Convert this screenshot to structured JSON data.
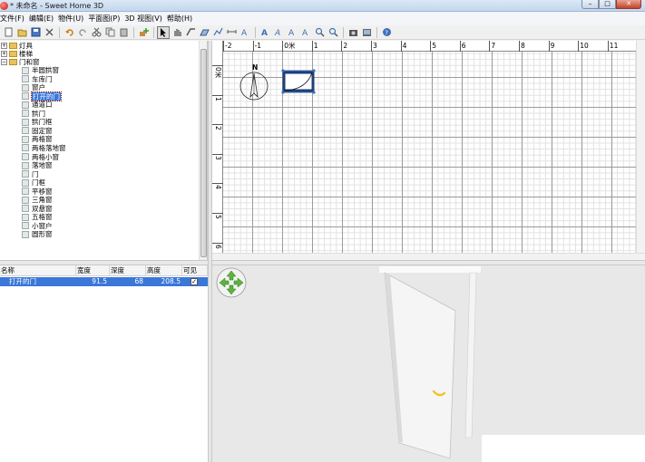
{
  "window": {
    "title": "* 未命名 - Sweet Home 3D",
    "controls": {
      "minimize": "–",
      "maximize": "□",
      "close": "✕"
    }
  },
  "menu": [
    "文件(F)",
    "编辑(E)",
    "物件(U)",
    "平面图(P)",
    "3D 视图(V)",
    "帮助(H)"
  ],
  "toolbar": {
    "buttons": [
      "new-icon",
      "open-icon",
      "save-icon",
      "cut-icon",
      "undo-icon",
      "redo-icon",
      "scissors-icon",
      "copy-icon",
      "paste-icon",
      "add-furniture-icon",
      "select-icon",
      "pan-icon",
      "create-walls-icon",
      "create-rooms-icon",
      "create-polylines-icon",
      "create-dimensions-icon",
      "create-labels-icon",
      "text-style-icon",
      "zoom-in-icon",
      "zoom-out-icon",
      "photo-icon",
      "video-icon",
      "help-icon"
    ],
    "selected": "select-icon"
  },
  "tree": {
    "categories": [
      {
        "label": "灯具",
        "expanded": false
      },
      {
        "label": "楼梯",
        "expanded": false
      },
      {
        "label": "门和窗",
        "expanded": true
      }
    ],
    "items": [
      "半圆拱窗",
      "车库门",
      "窗户",
      "打开的门",
      "通道口",
      "拱门",
      "拱门框",
      "固定窗",
      "两格窗",
      "两格落地窗",
      "两格小窗",
      "落地窗",
      "门",
      "门框",
      "平移窗",
      "三角窗",
      "双悬窗",
      "五格窗",
      "小窗户",
      "圆形窗"
    ],
    "selected_item": "打开的门"
  },
  "table": {
    "columns": [
      "名称",
      "宽度",
      "深度",
      "高度",
      "可见"
    ],
    "rows": [
      {
        "name": "打开的门",
        "width": "91.5",
        "depth": "68",
        "height": "208.5",
        "visible": "✓"
      }
    ]
  },
  "plan": {
    "ruler_top": [
      "-2",
      "-1",
      "0米",
      "1",
      "2",
      "3",
      "4",
      "5",
      "6",
      "7",
      "8",
      "9",
      "10",
      "11"
    ],
    "ruler_left": [
      "0米",
      "1",
      "2",
      "3",
      "4",
      "5",
      "6"
    ],
    "compass_label": "N"
  },
  "colors": {
    "selection": "#3a77d8",
    "title_bar": "#c4d7ee",
    "nav_arrows": "#5db33c",
    "door_handle": "#f0c21a"
  }
}
